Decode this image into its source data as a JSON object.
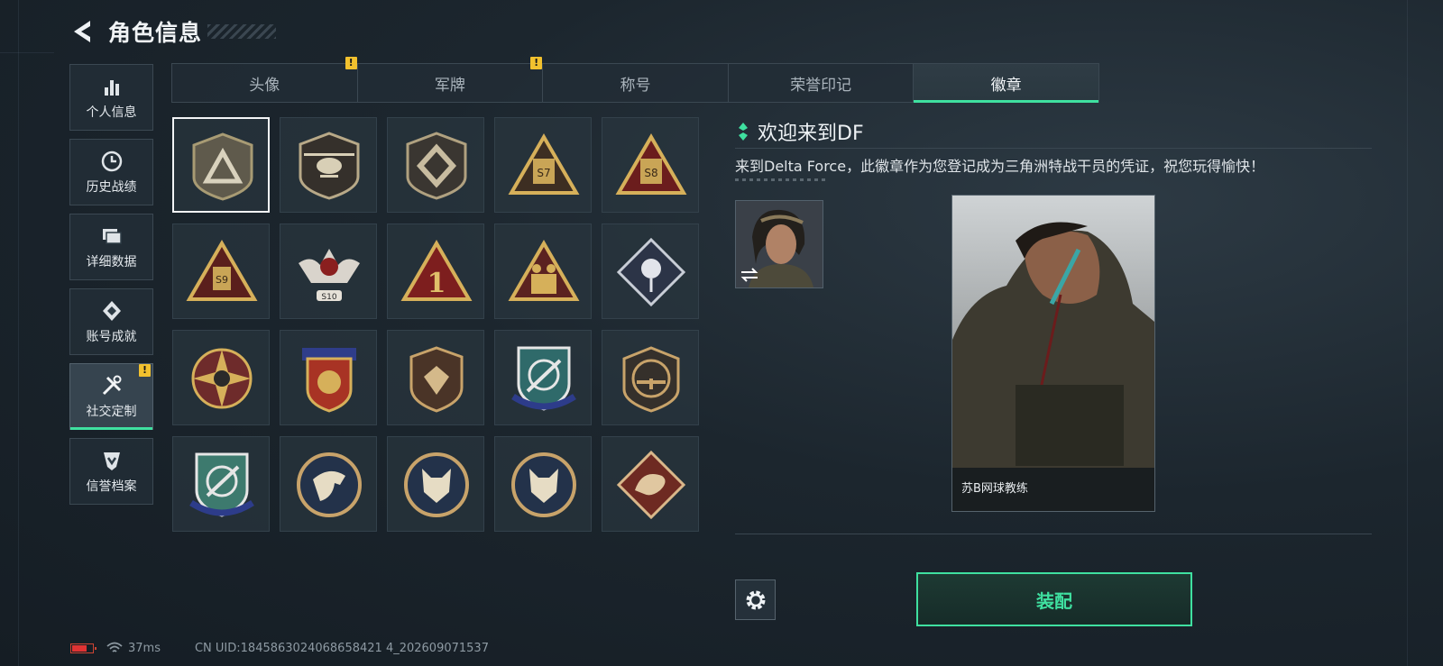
{
  "header": {
    "title": "角色信息"
  },
  "sidebar": {
    "items": [
      {
        "label": "个人信息",
        "icon": "bar-chart-icon"
      },
      {
        "label": "历史战绩",
        "icon": "clock-icon"
      },
      {
        "label": "详细数据",
        "icon": "folder-icon"
      },
      {
        "label": "账号成就",
        "icon": "achievement-icon"
      },
      {
        "label": "社交定制",
        "icon": "tools-icon",
        "active": true,
        "alert": "!"
      },
      {
        "label": "信誉档案",
        "icon": "shield-check-icon"
      }
    ]
  },
  "tabs": [
    {
      "label": "头像",
      "alert": "!"
    },
    {
      "label": "军牌",
      "alert": "!"
    },
    {
      "label": "称号"
    },
    {
      "label": "荣誉印记"
    },
    {
      "label": "徽章",
      "active": true
    }
  ],
  "badges": [
    {
      "name": "delta-shield-badge",
      "selected": true
    },
    {
      "name": "helicopter-badge"
    },
    {
      "name": "diamond-emblem-badge"
    },
    {
      "name": "s7-triangle-badge",
      "text": "S7"
    },
    {
      "name": "s8-triangle-badge",
      "text": "S8"
    },
    {
      "name": "s9-triangle-badge",
      "text": "S9"
    },
    {
      "name": "s10-winged-skull-badge",
      "text": "S10"
    },
    {
      "name": "number-one-triangle-badge",
      "text": "1"
    },
    {
      "name": "soldiers-triangle-badge"
    },
    {
      "name": "rose-diamond-badge"
    },
    {
      "name": "star-compass-badge"
    },
    {
      "name": "eagle-crest-badge"
    },
    {
      "name": "gem-shield-badge"
    },
    {
      "name": "crosshair-rifle-badge"
    },
    {
      "name": "rifle-seal-badge"
    },
    {
      "name": "crosshair-knife-badge"
    },
    {
      "name": "eagle-head-badge"
    },
    {
      "name": "wolf-head-badge"
    },
    {
      "name": "wolf-head-badge-2"
    },
    {
      "name": "dragon-diamond-badge"
    }
  ],
  "detail": {
    "title": "欢迎来到DF",
    "description": "来到Delta Force，此徽章作为您登记成为三角洲特战干员的凭证，祝您玩得愉快！",
    "card_name": "苏B网球教练"
  },
  "actions": {
    "equip_label": "装配",
    "settings_icon": "gear-icon",
    "swap_icon": "swap-icon"
  },
  "status": {
    "ping": "37ms",
    "uid": "CN UID:1845863024068658421 4_202609071537"
  },
  "colors": {
    "accent": "#3fe0a0",
    "alert": "#f2c12e",
    "battery": "#e03333"
  }
}
